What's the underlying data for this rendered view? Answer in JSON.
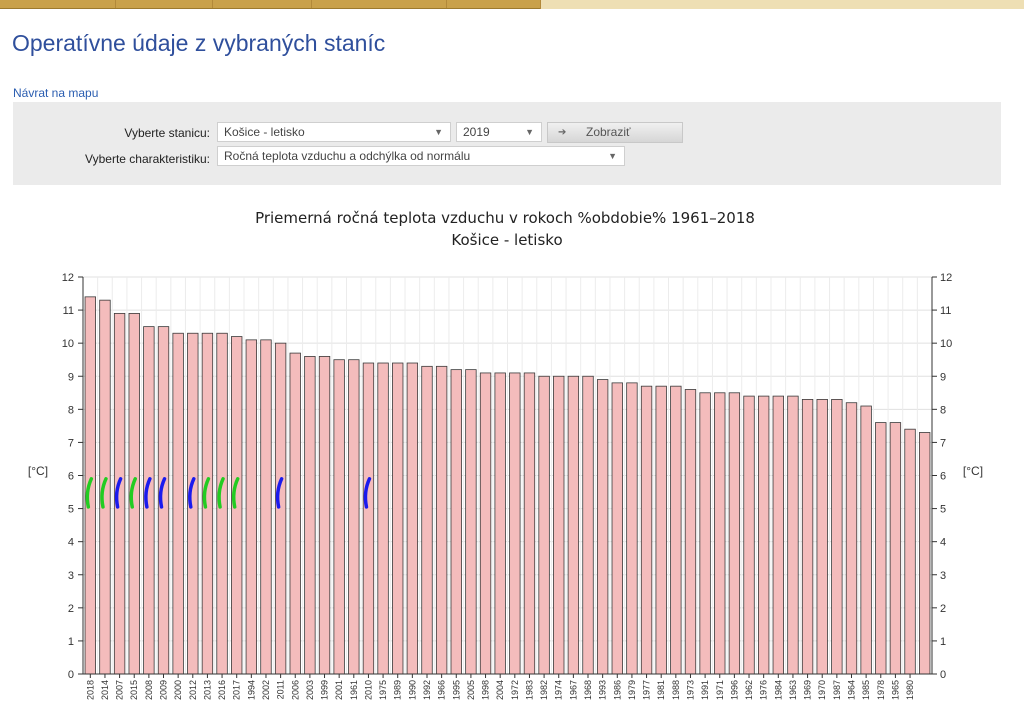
{
  "page": {
    "title": "Operatívne údaje z vybraných staníc",
    "back_link": "Návrat na mapu"
  },
  "filters": {
    "station_label": "Vyberte stanicu:",
    "station_value": "Košice - letisko",
    "year_value": "2019",
    "show_button": "Zobraziť",
    "characteristic_label": "Vyberte charakteristiku:",
    "characteristic_value": "Ročná teplota vzduchu a odchýlka od normálu"
  },
  "colors": {
    "bar_fill": "#f4bcbc",
    "bar_stroke": "#3a3a3a",
    "title_blue": "#2f4f9c",
    "link_blue": "#2a5db0",
    "green_mark": "#22cc22",
    "blue_mark": "#1a1aee"
  },
  "icons": {
    "dropdown": "caret-down-icon",
    "show": "arrow-right-icon"
  },
  "chart_data": {
    "type": "bar",
    "title": "Priemerná ročná teplota vzduchu v rokoch %obdobie% 1961–2018",
    "subtitle": "Košice - letisko",
    "ylabel": "[°C]",
    "ylim": [
      0,
      12
    ],
    "yticks": [
      0,
      1,
      2,
      3,
      4,
      5,
      6,
      7,
      8,
      9,
      10,
      11,
      12
    ],
    "grid": true,
    "categories": [
      "2018",
      "2014",
      "2007",
      "2015",
      "2008",
      "2009",
      "2000",
      "2012",
      "2013",
      "2016",
      "2017",
      "1994",
      "2002",
      "2011",
      "2006",
      "2003",
      "1999",
      "2001",
      "1961",
      "2010",
      "1975",
      "1989",
      "1990",
      "1992",
      "1966",
      "1995",
      "2005",
      "1998",
      "2004",
      "1972",
      "1983",
      "1982",
      "1974",
      "1967",
      "1968",
      "1993",
      "1986",
      "1979",
      "1977",
      "1981",
      "1988",
      "1973",
      "1991",
      "1971",
      "1996",
      "1962",
      "1976",
      "1984",
      "1963",
      "1969",
      "1970",
      "1987",
      "1964",
      "1985",
      "1978",
      "1965",
      "1980"
    ],
    "values": [
      11.4,
      11.3,
      10.9,
      10.9,
      10.5,
      10.5,
      10.3,
      10.3,
      10.3,
      10.3,
      10.2,
      10.1,
      10.1,
      10.0,
      9.7,
      9.6,
      9.6,
      9.5,
      9.5,
      9.4,
      9.4,
      9.4,
      9.4,
      9.3,
      9.3,
      9.2,
      9.2,
      9.1,
      9.1,
      9.1,
      9.1,
      9.0,
      9.0,
      9.0,
      9.0,
      8.9,
      8.8,
      8.8,
      8.7,
      8.7,
      8.7,
      8.6,
      8.5,
      8.5,
      8.5,
      8.4,
      8.4,
      8.4,
      8.4,
      8.3,
      8.3,
      8.3,
      8.2,
      8.1,
      7.6,
      7.6,
      7.4,
      7.3
    ],
    "markers": [
      {
        "category": "2018",
        "color": "green"
      },
      {
        "category": "2014",
        "color": "green"
      },
      {
        "category": "2007",
        "color": "blue"
      },
      {
        "category": "2015",
        "color": "green"
      },
      {
        "category": "2008",
        "color": "blue"
      },
      {
        "category": "2009",
        "color": "blue"
      },
      {
        "category": "2012",
        "color": "blue"
      },
      {
        "category": "2013",
        "color": "green"
      },
      {
        "category": "2016",
        "color": "green"
      },
      {
        "category": "2017",
        "color": "green"
      },
      {
        "category": "2011",
        "color": "blue"
      },
      {
        "category": "2010",
        "color": "blue"
      }
    ]
  }
}
